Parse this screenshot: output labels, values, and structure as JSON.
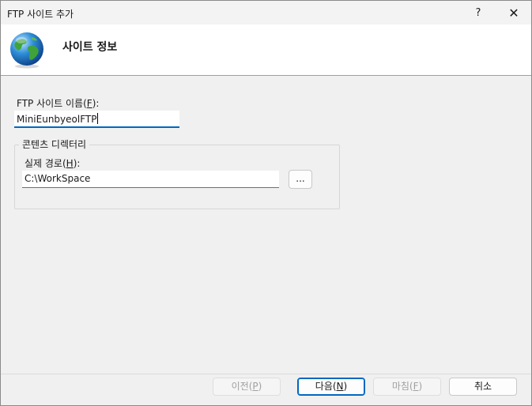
{
  "window": {
    "title": "FTP 사이트 추가",
    "help_label": "?",
    "close_label": "✕"
  },
  "header": {
    "title": "사이트 정보",
    "icon": "globe-icon"
  },
  "site_name": {
    "label": "FTP 사이트 이름(",
    "accel": "F",
    "label_end": "):",
    "value": "MiniEunbyeolFTP"
  },
  "content_directory": {
    "legend": "콘텐츠 디렉터리",
    "physical_path": {
      "label": "실제 경로(",
      "accel": "H",
      "label_end": "):",
      "value": "C:\\WorkSpace"
    },
    "browse_label": "..."
  },
  "footer": {
    "previous": {
      "label": "이전(",
      "accel": "P",
      "end": ")",
      "enabled": false
    },
    "next": {
      "label": "다음(",
      "accel": "N",
      "end": ")",
      "enabled": true
    },
    "finish": {
      "label": "마침(",
      "accel": "F",
      "end": ")",
      "enabled": false
    },
    "cancel": {
      "label": "취소",
      "enabled": true
    }
  },
  "colors": {
    "accent": "#0067c0",
    "background": "#f0f0f0"
  }
}
